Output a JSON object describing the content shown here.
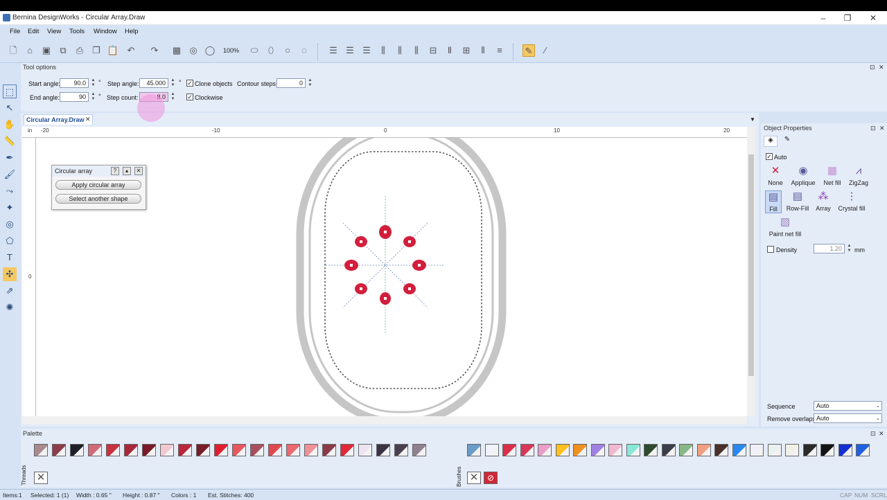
{
  "window": {
    "title": "Bernina DesignWorks - Circular Array.Draw",
    "minimize": "–",
    "maximize": "❐",
    "close": "✕"
  },
  "menu": [
    "File",
    "Edit",
    "View",
    "Tools",
    "Window",
    "Help"
  ],
  "toolbar": {
    "zoom": "100%"
  },
  "tool_options": {
    "title": "Tool options",
    "start_angle_label": "Start angle:",
    "start_angle": "90.0",
    "step_angle_label": "Step angle:",
    "step_angle": "45.000",
    "end_angle_label": "End angle:",
    "end_angle": "90",
    "step_count_label": "Step count:",
    "step_count": "8.0",
    "deg": "°",
    "clone_label": "Clone objects",
    "clockwise_label": "Clockwise",
    "contour_label": "Contour steps:",
    "contour_steps": "0",
    "pin": "⊡",
    "close": "✕"
  },
  "document": {
    "tab": "Circular Array.Draw",
    "tab_close": "✕",
    "ruler_unit": "in",
    "ruler": [
      "-20",
      "-10",
      "0",
      "10",
      "20"
    ],
    "vruler": "0"
  },
  "dialog": {
    "title": "Circular array",
    "help": "?",
    "apply": "Apply circular array",
    "select": "Select another shape"
  },
  "object_properties": {
    "title": "Object Properties",
    "auto_label": "Auto",
    "fills": [
      "None",
      "Applique",
      "Net fill",
      "ZigZag",
      "Fill",
      "Row-Fill",
      "Array",
      "Crystal fill",
      "Paint net fill"
    ],
    "density_label": "Density",
    "density": "1.20",
    "density_unit": "mm",
    "sequence_label": "Sequence",
    "sequence": "Auto",
    "remove_overlaps_label": "Remove overlaps",
    "remove_overlaps": "Auto"
  },
  "palette": {
    "title": "Palette",
    "threads": "Threads",
    "brushes": "Brushes",
    "colors_left": [
      "#a88a8e",
      "#8c3c4a",
      "#1e1e2a",
      "#d06a78",
      "#c8323c",
      "#a8283a",
      "#7a1a28",
      "#f2c8d0",
      "#b8283c",
      "#781e2a",
      "#e02030",
      "#e85860",
      "#a85060",
      "#e04850",
      "#ec6870",
      "#f09098",
      "#8c3a48",
      "#e02838",
      "#ede4f2",
      "#3c3444",
      "#484050",
      "#908090"
    ],
    "colors_right": [
      "#6a9cc8",
      "#f0f4fa",
      "#dc2e4a",
      "#d83858",
      "#e8a0c8",
      "#ffc020",
      "#f09020",
      "#a080e0",
      "#f0b8d0",
      "#88e8d8",
      "#2e4a2e",
      "#3a3e4a",
      "#88b888",
      "#f0a080",
      "#4a3028",
      "#2888f0",
      "#f0f0f8",
      "#e8f0f0",
      "#f0f0e8",
      "#2a2a2a",
      "#141414",
      "#1430d0",
      "#2060e0"
    ]
  },
  "status": {
    "items": "Items:1",
    "selected": "Selected: 1 (1)",
    "width": "Width : 0.65 \"",
    "height": "Height : 0.87 \"",
    "colors": "Colors : 1",
    "stitches": "Est. Stitches: 400",
    "caps": "CAP",
    "num": "NUM",
    "scrl": "SCRL"
  },
  "colors": {
    "accent": "#1e4e96",
    "stitch_red": "#d21f3c"
  }
}
